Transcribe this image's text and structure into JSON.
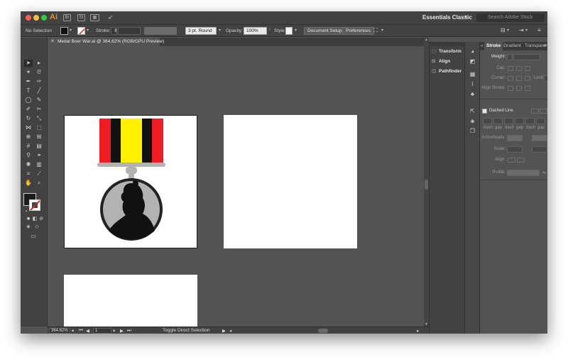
{
  "app": {
    "logo": "Ai",
    "workspace": "Essentials Classic",
    "search_placeholder": "Search Adobe Stock",
    "bridge_label": "Br",
    "stock_label": "St"
  },
  "control_bar": {
    "selection": "No Selection",
    "stroke_label": "Stroke:",
    "brush": "3 pt. Round",
    "opacity_label": "Opacity:",
    "opacity_value": "100%",
    "style_label": "Style:",
    "document_setup": "Document Setup",
    "preferences": "Preferences"
  },
  "document": {
    "tab_title": "Medal Boer War.ai @ 364.62% (RGB/GPU Preview)",
    "close": "✕"
  },
  "status": {
    "zoom": "364.62%",
    "artboard": "1",
    "tool": "Toggle Direct Selection"
  },
  "mid_panel": {
    "items": [
      {
        "label": "Transform",
        "icon": "transform-icon"
      },
      {
        "label": "Align",
        "icon": "align-icon"
      },
      {
        "label": "Pathfinder",
        "icon": "pathfinder-icon"
      }
    ]
  },
  "right_panel": {
    "tabs": [
      "Stroke",
      "Gradient",
      "Transparency"
    ],
    "weight_label": "Weight:",
    "cap_label": "Cap:",
    "corner_label": "Corner:",
    "limit_label": "Limit:",
    "align_stroke_label": "Align Stroke:",
    "dashed_line_label": "Dashed Line",
    "dash_fields": [
      "dash",
      "gap",
      "dash",
      "gap",
      "dash",
      "gap"
    ],
    "arrowheads_label": "Arrowheads:",
    "scale_label": "Scale:",
    "align_label": "Align:",
    "profile_label": "Profile:"
  },
  "colors": {
    "ribbon_red": "#ee1c25",
    "ribbon_black": "#111111",
    "ribbon_yellow": "#fff200",
    "medal_gray": "#b2b2b2",
    "medal_rim": "#222222",
    "silhouette": "#111111"
  }
}
